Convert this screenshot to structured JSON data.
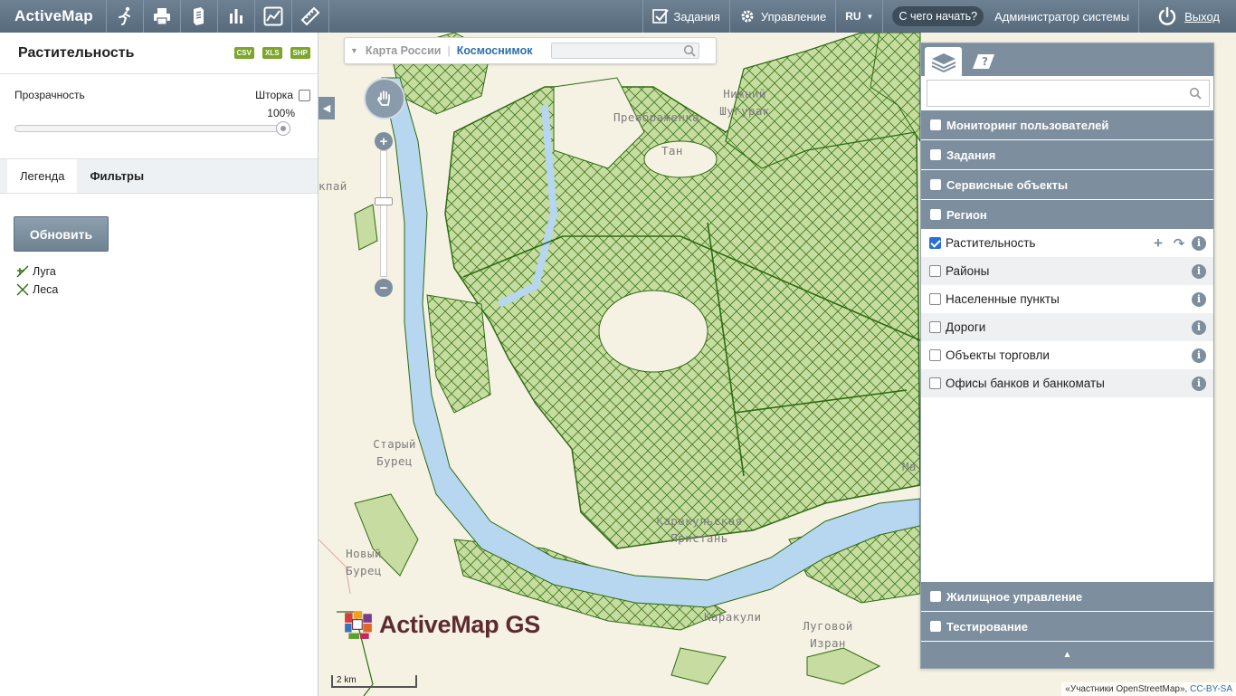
{
  "app": {
    "brand": "ActiveMap"
  },
  "toolbar": {
    "tools": [
      "route-icon",
      "print-icon",
      "document-icon",
      "bar-chart-icon",
      "line-chart-icon",
      "ruler-icon"
    ],
    "tasks_label": "Задания",
    "management_label": "Управление",
    "language": "RU",
    "help_label": "С чего начать?",
    "user_label": "Администратор системы",
    "exit_label": "Выход"
  },
  "left_panel": {
    "title": "Растительность",
    "export_badges": [
      "CSV",
      "XLS",
      "SHP"
    ],
    "opacity_label": "Прозрачность",
    "curtain_label": "Шторка",
    "opacity_value": "100%",
    "opacity_fraction": 1.0,
    "tabs": [
      "Легенда",
      "Фильтры"
    ],
    "refresh_label": "Обновить",
    "legend": [
      {
        "label": "Луга",
        "icon": "meadow-symbol-icon"
      },
      {
        "label": "Леса",
        "icon": "forest-symbol-icon"
      }
    ]
  },
  "map": {
    "basemaps": {
      "russia": "Карта России",
      "satellite": "Космоснимок"
    },
    "search_placeholder": "",
    "places": [
      {
        "text": "Преображенка"
      },
      {
        "text": "Нижний\nШугурак"
      },
      {
        "text": "Тан"
      },
      {
        "text": "кпай"
      },
      {
        "text": "Старый\nБурец"
      },
      {
        "text": "Новый\nБурец"
      },
      {
        "text": "Каракульская\nПристань"
      },
      {
        "text": "Каракули"
      },
      {
        "text": "Луговой\nИзран"
      },
      {
        "text": "Ма"
      }
    ],
    "logo_text": "ActiveMap GS",
    "scale_label": "2 km",
    "attribution": "«Участники OpenStreetMap»,",
    "attribution_link": "CC-BY-SA"
  },
  "layers_panel": {
    "search_placeholder": "",
    "groups_top": [
      "Мониторинг пользователей",
      "Задания",
      "Сервисные объекты",
      "Регион"
    ],
    "layers": [
      {
        "name": "Растительность",
        "checked": true
      },
      {
        "name": "Районы",
        "checked": false
      },
      {
        "name": "Населенные пункты",
        "checked": false
      },
      {
        "name": "Дороги",
        "checked": false
      },
      {
        "name": "Объекты торговли",
        "checked": false
      },
      {
        "name": "Офисы банков и банкоматы",
        "checked": false
      }
    ],
    "groups_bottom": [
      "Жилищное управление",
      "Тестирование"
    ]
  },
  "colors": {
    "topbar": "#5f7385",
    "panel_header": "#7d8f9e",
    "forest_fill": "#c6dca0",
    "forest_stroke": "#2e6a12",
    "river": "#b7d6ef",
    "accent_link": "#2d6fa8"
  }
}
